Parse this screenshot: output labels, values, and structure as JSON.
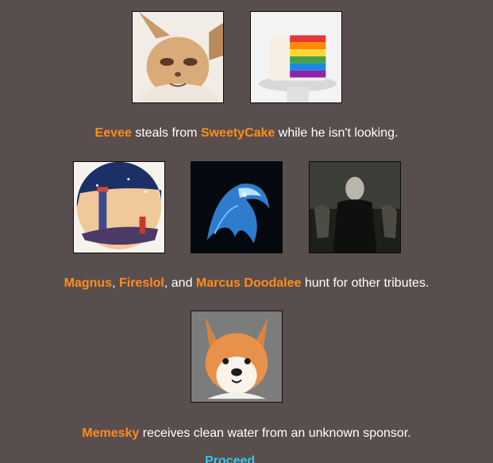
{
  "events": [
    {
      "line1_names": [
        "Eevee",
        "SweetyCake"
      ],
      "text": {
        "steals": "steals from",
        "tail": "while he isn't looking."
      }
    },
    {
      "names": [
        "Magnus",
        "Fireslol",
        "Marcus Doodalee"
      ],
      "text": {
        "sep1": ",",
        "sep2": ", and",
        "tail": "hunt for other tributes."
      }
    },
    {
      "names": [
        "Memesky"
      ],
      "text": {
        "tail": "receives clean water from an unknown sponsor."
      }
    }
  ],
  "proceed_label": "Proceed",
  "colors": {
    "background": "#594e4e",
    "tribute_name": "#ff8c1a",
    "text": "#ffffff",
    "link": "#32c8ee"
  }
}
